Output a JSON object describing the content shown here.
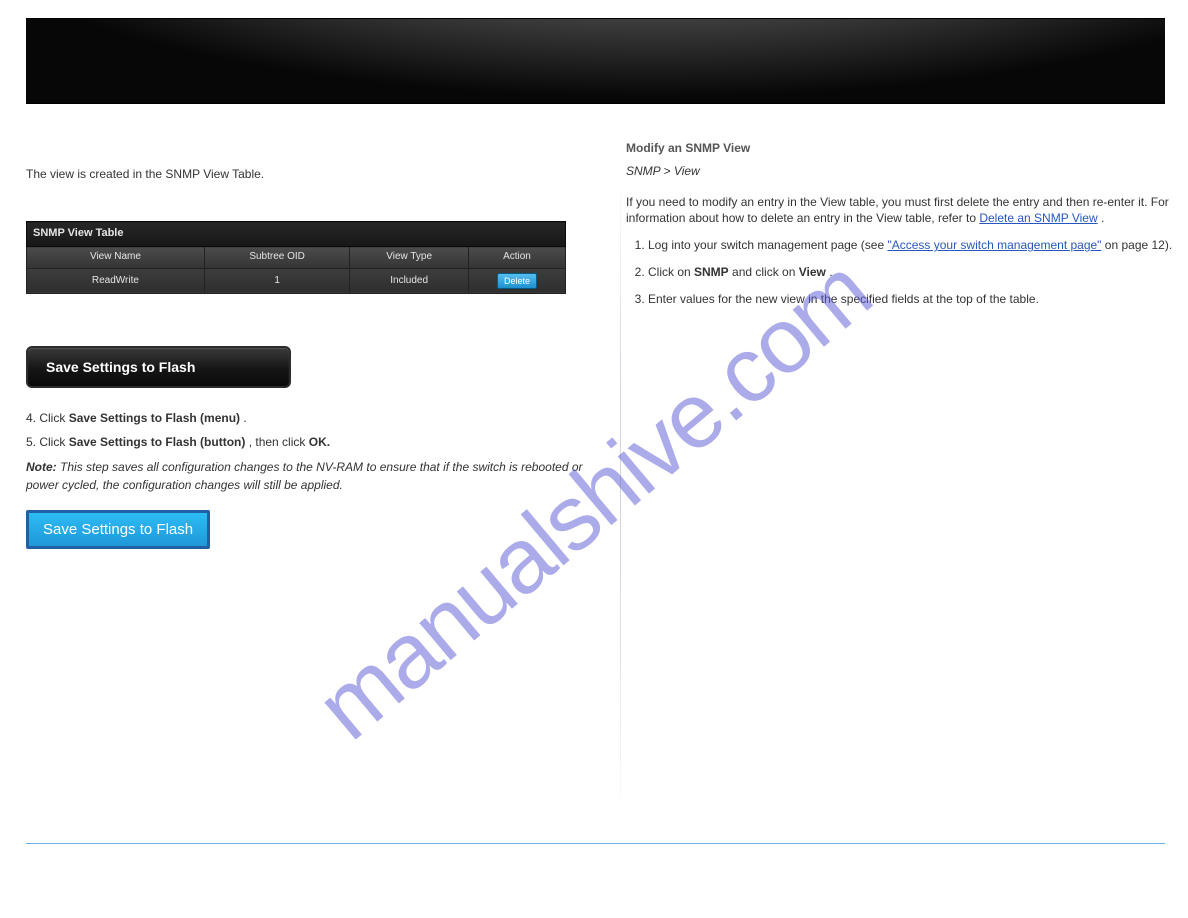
{
  "leftColumn": {
    "intro": "The view is created in the SNMP View Table.",
    "snmpTable": {
      "title": "SNMP View Table",
      "headers": [
        "View Name",
        "Subtree OID",
        "View Type",
        "Action"
      ],
      "row": {
        "viewName": "ReadWrite",
        "subtreeOid": "1",
        "viewType": "Included",
        "actionLabel": "Delete"
      }
    },
    "btnFlashDark": "Save Settings to Flash",
    "instr": {
      "line4a": "4. ",
      "line4b": "Click ",
      "line4c": "Save Settings to Flash (menu)",
      "line4d": ".",
      "line5a": "5. ",
      "line5b": "Click ",
      "line5c": "Save Settings to Flash (button)",
      "line5d": ", then click ",
      "line5e": "OK.",
      "noteLabel": "Note:",
      "noteText": " This step saves all configuration changes to the NV-RAM to ensure that if the switch is rebooted or power cycled, the configuration changes will still be applied."
    },
    "btnFlashBlue": "Save Settings to Flash"
  },
  "rightColumn": {
    "title": "Modify an SNMP View",
    "navLabel": "SNMP > View",
    "para1a": "If you need to modify an entry in the View table, you must first delete the entry and then re-enter it. For information about how to delete an entry in the View table, refer to ",
    "linkRef": "Delete an SNMP View",
    "para1b": ".",
    "steps": [
      {
        "a": "Log into your switch management page (see ",
        "link": "\"Access your switch management page\"",
        "b": " on page 12)."
      },
      {
        "a": "Click on ",
        "b1": "SNMP",
        "c": " and click on ",
        "b2": "View",
        "d": "."
      },
      {
        "plain": "Enter values for the new view in the specified fields at the top of the table."
      }
    ]
  },
  "watermark": "manualshive.com"
}
